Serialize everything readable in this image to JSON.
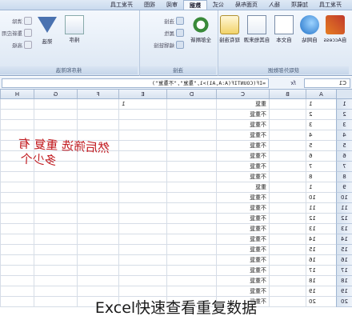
{
  "ribbon": {
    "tabs": [
      "开发工具",
      "加载项",
      "插入",
      "页面布局",
      "公式",
      "数据",
      "审阅",
      "视图",
      "开发工具"
    ],
    "active_tab": "数据",
    "groups": {
      "external": {
        "title": "获取外部数据",
        "buttons": [
          "自Access",
          "自网站",
          "自文本",
          "自其他来源",
          "现有连接"
        ]
      },
      "connections": {
        "title": "连接",
        "big": "全部刷新",
        "small": [
          "连接",
          "属性",
          "编辑链接"
        ]
      },
      "sort": {
        "title": "排序和筛选",
        "big": [
          "排序",
          "筛选"
        ],
        "small": [
          "清除",
          "重新应用",
          "高级"
        ]
      }
    }
  },
  "formula_bar": {
    "name_box": "C1",
    "fx": "fx",
    "formula": "=IF(COUNTIF(A:A,A1)>1,\"重复\",\"不重复\")"
  },
  "grid": {
    "columns": [
      "A",
      "B",
      "C",
      "D",
      "E",
      "F",
      "G",
      "H"
    ],
    "rows": [
      {
        "n": "1",
        "a": "1",
        "c": "重复",
        "e": "1"
      },
      {
        "n": "2",
        "a": "2",
        "c": "不重复",
        "e": ""
      },
      {
        "n": "3",
        "a": "3",
        "c": "不重复",
        "e": ""
      },
      {
        "n": "4",
        "a": "4",
        "c": "不重复",
        "e": ""
      },
      {
        "n": "5",
        "a": "5",
        "c": "不重复",
        "e": ""
      },
      {
        "n": "6",
        "a": "6",
        "c": "不重复",
        "e": ""
      },
      {
        "n": "7",
        "a": "7",
        "c": "不重复",
        "e": ""
      },
      {
        "n": "8",
        "a": "8",
        "c": "不重复",
        "e": ""
      },
      {
        "n": "9",
        "a": "1",
        "c": "重复",
        "e": ""
      },
      {
        "n": "10",
        "a": "10",
        "c": "不重复",
        "e": ""
      },
      {
        "n": "11",
        "a": "11",
        "c": "不重复",
        "e": ""
      },
      {
        "n": "12",
        "a": "12",
        "c": "不重复",
        "e": ""
      },
      {
        "n": "13",
        "a": "13",
        "c": "不重复",
        "e": ""
      },
      {
        "n": "14",
        "a": "14",
        "c": "不重复",
        "e": ""
      },
      {
        "n": "15",
        "a": "15",
        "c": "不重复",
        "e": ""
      },
      {
        "n": "16",
        "a": "16",
        "c": "不重复",
        "e": ""
      },
      {
        "n": "17",
        "a": "17",
        "c": "不重复",
        "e": ""
      },
      {
        "n": "18",
        "a": "18",
        "c": "不重复",
        "e": ""
      },
      {
        "n": "19",
        "a": "19",
        "c": "不重复",
        "e": ""
      },
      {
        "n": "20",
        "a": "20",
        "c": "不重复",
        "e": ""
      }
    ]
  },
  "annotation": {
    "line1": "然后筛选 重复 有",
    "line2": "多少个"
  },
  "caption": "Excel快速查看重复数据"
}
